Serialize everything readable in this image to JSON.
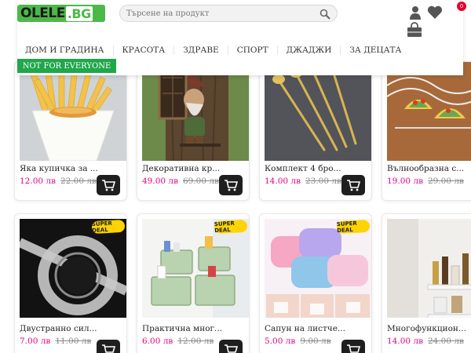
{
  "header": {
    "logo": {
      "main": "OLELE",
      "tld": ".BG"
    },
    "search": {
      "placeholder": "Търсене на продукт"
    },
    "wishlist_count": "0",
    "nav": [
      "ДОМ И ГРАДИНА",
      "КРАСОТА",
      "ЗДРАВЕ",
      "СПОРТ",
      "ДЖАДЖИ",
      "ЗА ДЕЦАТА"
    ],
    "promo_link": "NOT FOR EVERYONE"
  },
  "products": [
    {
      "name": "Яка купичка за ...",
      "price": "12.00 лв",
      "old_price": "22.00 лв",
      "badge": ""
    },
    {
      "name": "Декоративна кр...",
      "price": "49.00 лв",
      "old_price": "69.00 лв",
      "badge": ""
    },
    {
      "name": "Комплект 4 бро...",
      "price": "14.00 лв",
      "old_price": "23.00 лв",
      "badge": ""
    },
    {
      "name": "Вълнообразна с...",
      "price": "19.00 лв",
      "old_price": "29.00 лв",
      "badge": ""
    },
    {
      "name": "Двустранно сил...",
      "price": "7.00 лв",
      "old_price": "11.00 лв",
      "badge": "SUPER DEAL"
    },
    {
      "name": "Практична мног...",
      "price": "6.00 лв",
      "old_price": "12.00 лв",
      "badge": "SUPER DEAL"
    },
    {
      "name": "Сапун на листче...",
      "price": "5.00 лв",
      "old_price": "9.00 лв",
      "badge": "SUPER DEAL"
    },
    {
      "name": "Многофункцион...",
      "price": "14.00 лв",
      "old_price": "24.00 лв",
      "badge": ""
    }
  ],
  "colors": {
    "brand_green": "#4cb848",
    "promo_green": "#1fa74a",
    "price_pink": "#e6007e",
    "badge_yellow": "#ffd400"
  },
  "icons": [
    "search-icon",
    "user-icon",
    "heart-icon",
    "shopping-bag-icon",
    "cart-icon"
  ]
}
